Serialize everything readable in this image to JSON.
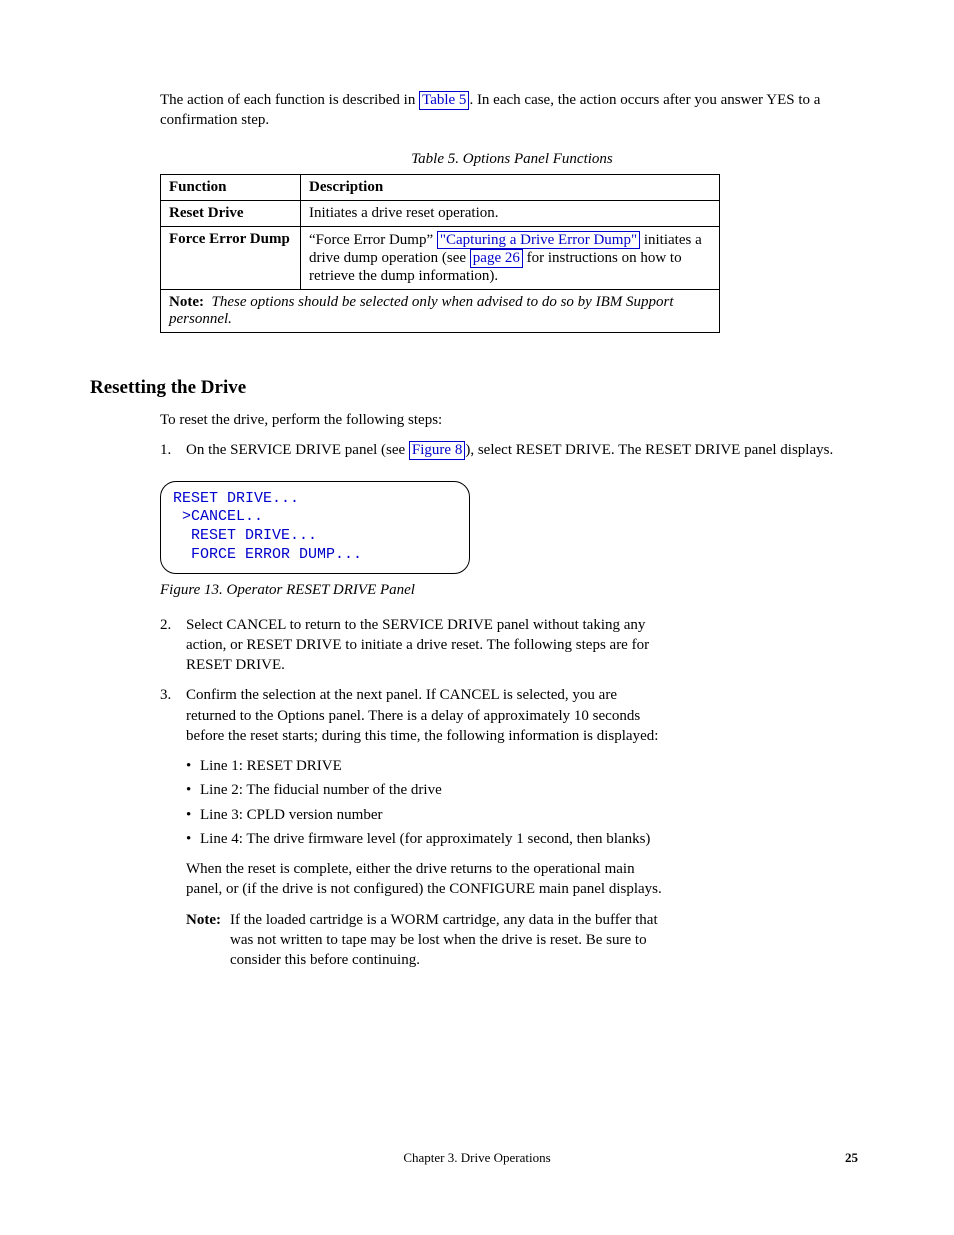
{
  "para1_before_link": "The action of each function is described in ",
  "link_table5": "Table 5",
  "para1_after_link": ". In each case, the action occurs after you answer YES to a confirmation step.",
  "table5": {
    "caption_idx": "Table 5.",
    "caption_text": "Options Panel Functions",
    "rows": [
      {
        "head": "Function",
        "desc": "Description"
      },
      {
        "head": "Reset Drive",
        "desc": "Initiates a drive reset operation."
      },
      {
        "head": "Force Error Dump",
        "desc_open": "“Force Error Dump” ",
        "desc_cap_text": "\"Capturing a Drive Error Dump\"",
        "desc_mid": " initiates a drive dump operation (see ",
        "page_link": "page 26",
        "desc_close": " for instructions on how to retrieve the dump information)."
      },
      {
        "note": "Note:  These options should be selected only when advised to do so by IBM Support personnel."
      }
    ]
  },
  "section_title": "Resetting the Drive",
  "reset_p1": "To reset the drive, perform the following steps:",
  "steps": [
    {
      "num": "1.",
      "text_before": "On the SERVICE DRIVE panel (see ",
      "link": "Figure 8",
      "text_after": "), select RESET DRIVE. The RESET DRIVE panel displays."
    }
  ],
  "display_lines": [
    "RESET DRIVE...",
    " >CANCEL..",
    "  RESET DRIVE...",
    "  FORCE ERROR DUMP..."
  ],
  "fig_caption_idx": "Figure 13.",
  "fig_caption_text": "Operator RESET DRIVE Panel",
  "steps2": [
    {
      "num": "2.",
      "lines": [
        "Select CANCEL to return to the SERVICE DRIVE panel without taking any",
        "action, or RESET DRIVE to initiate a drive reset. The following steps are for",
        "RESET DRIVE."
      ]
    },
    {
      "num": "3.",
      "lines": [
        "Confirm the selection at the next panel. If CANCEL is selected, you are",
        "returned to the Options panel. There is a delay of approximately 10 seconds",
        "before the reset starts; during this time, the following information is displayed:"
      ]
    }
  ],
  "sublist": [
    "Line 1: RESET DRIVE",
    "Line 2: The fiducial number of the drive",
    "Line 3: CPLD version number",
    "Line 4: The drive firmware level (for approximately 1 second, then blanks)"
  ],
  "para2_lines": [
    "When the reset is complete, either the drive returns to the operational main",
    "panel, or (if the drive is not configured) the CONFIGURE main panel displays."
  ],
  "note_head": "Note:",
  "note_lines": [
    "If the loaded cartridge is a WORM cartridge, any data in the buffer that",
    "was not written to tape may be lost when the drive is reset. Be sure to",
    "consider this before continuing."
  ],
  "footer_chapter": "Chapter 3. Drive Operations",
  "footer_page": "25"
}
